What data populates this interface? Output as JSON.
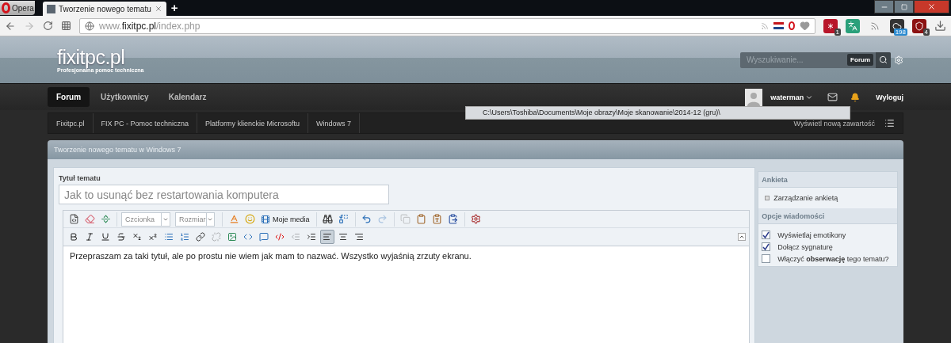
{
  "browser": {
    "menu_button": "Opera",
    "tabs": [
      {
        "title": "Tworzenie nowego tematu",
        "selected": true
      }
    ],
    "new_tab": "+",
    "address": {
      "prefix": "www.",
      "domain": "fixitpc.pl",
      "path": "/index.php"
    },
    "extensions": [
      {
        "kind": "asterisk",
        "badge": "1"
      },
      {
        "kind": "translate"
      },
      {
        "kind": "feed"
      },
      {
        "kind": "counter",
        "badge": "198"
      },
      {
        "kind": "shield",
        "badge": "4"
      }
    ]
  },
  "header": {
    "logo": "fixitpc.pl",
    "tagline": "Profesjonalna pomoc techniczna",
    "search_placeholder": "Wyszukiwanie...",
    "search_scope": "Forum"
  },
  "nav": {
    "tabs": [
      {
        "label": "Forum",
        "selected": true
      },
      {
        "label": "Użytkownicy",
        "selected": false
      },
      {
        "label": "Kalendarz",
        "selected": false
      }
    ],
    "user": "waterman",
    "logout": "Wyloguj"
  },
  "breadcrumbs": [
    "Fixitpc.pl",
    "FIX PC - Pomoc techniczna",
    "Platformy klienckie Microsoftu",
    "Windows 7"
  ],
  "new_content": "Wyświetl nową zawartość",
  "tooltip": "C:\\Users\\Toshiba\\Documents\\Moje obrazy\\Moje skanowanie\\2014-12 (gru)\\",
  "panel_title": "Tworzenie nowego tematu w Windows 7",
  "form": {
    "title_label": "Tytuł tematu",
    "title_value": "Jak to usunąć bez restartowania komputera"
  },
  "editor": {
    "toolbar_1": [
      {
        "kind": "icon",
        "disabled": false
      },
      {
        "kind": "icon",
        "disabled": false
      },
      {
        "kind": "icon",
        "disabled": false
      },
      {
        "kind": "separator"
      },
      {
        "kind": "select",
        "label": "Czcionka"
      },
      {
        "kind": "select",
        "label": "Rozmiar"
      },
      {
        "kind": "separator"
      },
      {
        "kind": "icon",
        "disabled": false
      },
      {
        "kind": "icon",
        "disabled": false
      },
      {
        "kind": "media",
        "label": "Moje media"
      },
      {
        "kind": "separator"
      },
      {
        "kind": "icon",
        "disabled": false
      },
      {
        "kind": "icon",
        "disabled": false
      },
      {
        "kind": "separator"
      },
      {
        "kind": "icon",
        "disabled": false
      },
      {
        "kind": "icon",
        "disabled": true
      },
      {
        "kind": "separator"
      },
      {
        "kind": "icon",
        "disabled": true
      },
      {
        "kind": "icon",
        "disabled": false
      },
      {
        "kind": "icon",
        "disabled": false
      },
      {
        "kind": "icon",
        "disabled": false
      },
      {
        "kind": "separator"
      },
      {
        "kind": "icon",
        "disabled": false
      }
    ],
    "toolbar_2": [
      {
        "selected": false,
        "disabled": false
      },
      {
        "selected": false,
        "disabled": false
      },
      {
        "selected": false,
        "disabled": false
      },
      {
        "selected": false,
        "disabled": false
      },
      {
        "selected": false,
        "disabled": false
      },
      {
        "selected": false,
        "disabled": false
      },
      {
        "selected": false,
        "disabled": false
      },
      {
        "selected": false,
        "disabled": false
      },
      {
        "selected": false,
        "disabled": false
      },
      {
        "selected": false,
        "disabled": true
      },
      {
        "selected": false,
        "disabled": false
      },
      {
        "selected": false,
        "disabled": false
      },
      {
        "selected": false,
        "disabled": false
      },
      {
        "selected": false,
        "disabled": false
      },
      {
        "selected": false,
        "disabled": true
      },
      {
        "selected": false,
        "disabled": false
      },
      {
        "selected": true,
        "disabled": false
      },
      {
        "selected": false,
        "disabled": false
      },
      {
        "selected": false,
        "disabled": false
      }
    ],
    "text": "Przepraszam za taki tytuł, ale po prostu nie wiem jak mam to nazwać. Wszystko wyjaśnią zrzuty ekranu."
  },
  "sidebar": {
    "poll_heading": "Ankieta",
    "poll_link": "Zarządzanie ankietą",
    "options_heading": "Opcje wiadomości",
    "options": [
      {
        "label": "Wyświetlaj emotikony",
        "checked": true
      },
      {
        "label": "Dołącz sygnaturę",
        "checked": true
      },
      {
        "label": "Włączyć **obserwację** tego tematu?",
        "checked": false
      }
    ]
  }
}
